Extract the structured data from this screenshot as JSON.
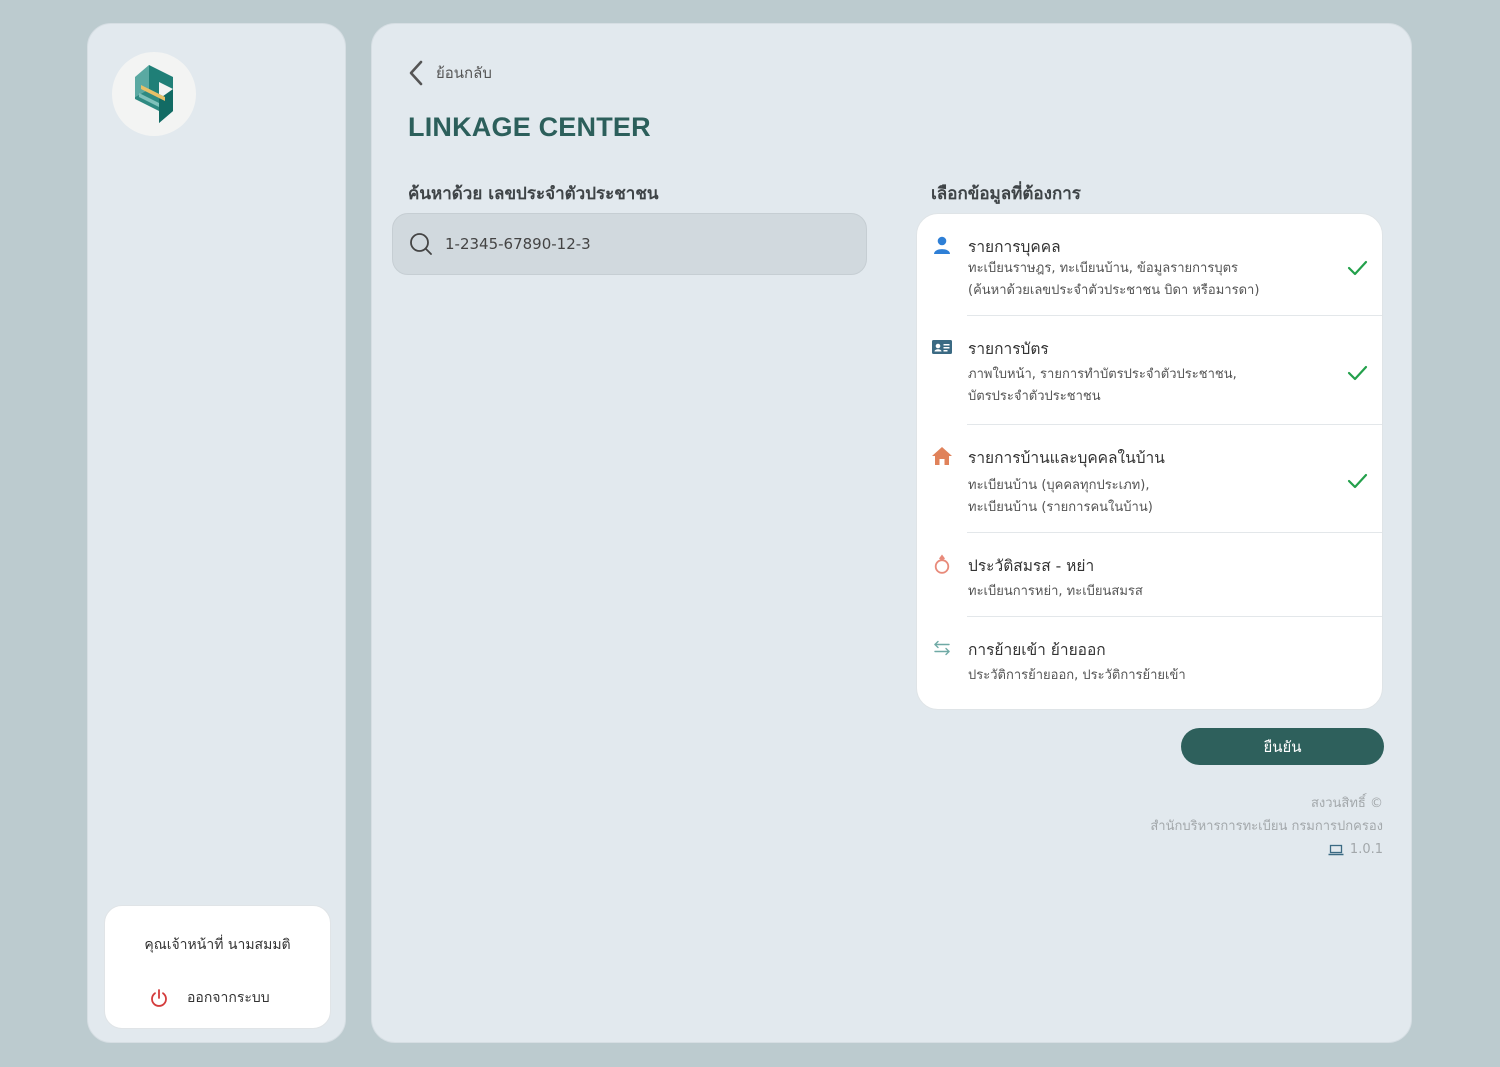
{
  "sidebar": {
    "user_name": "คุณเจ้าหน้าที่  นามสมมติ",
    "logout_label": "ออกจากระบบ"
  },
  "main": {
    "back_label": "ย้อนกลับ",
    "title": "LINKAGE CENTER",
    "search_label": "ค้นหาด้วย เลขประจำตัวประชาชน",
    "search_value": "1-2345-67890-12-3",
    "options_label": "เลือกข้อมูลที่ต้องการ",
    "options": [
      {
        "title": "รายการบุคคล",
        "desc_line1": "ทะเบียนราษฎร, ทะเบียนบ้าน, ข้อมูลรายการบุตร",
        "desc_line2": "(ค้นหาด้วยเลขประจำตัวประชาชน บิดา หรือมารดา)",
        "icon": "person-icon",
        "icon_color": "#2e7fd6",
        "selected": true
      },
      {
        "title": "รายการบัตร",
        "desc_line1": "ภาพใบหน้า, รายการทำบัตรประจำตัวประชาชน,",
        "desc_line2": "บัตรประจำตัวประชาชน",
        "icon": "id-card-icon",
        "icon_color": "#3b6a83",
        "selected": true
      },
      {
        "title": "รายการบ้านและบุคคลในบ้าน",
        "desc_line1": "ทะเบียนบ้าน (บุคคลทุกประเภท),",
        "desc_line2": "ทะเบียนบ้าน (รายการคนในบ้าน)",
        "icon": "house-icon",
        "icon_color": "#e0825a",
        "selected": true
      },
      {
        "title": "ประวัติสมรส - หย่า",
        "desc_line1": "ทะเบียนการหย่า, ทะเบียนสมรส",
        "icon": "ring-icon",
        "icon_color": "#e88a7a",
        "selected": false
      },
      {
        "title": "การย้ายเข้า ย้ายออก",
        "desc_line1": "ประวัติการย้ายออก, ประวัติการย้ายเข้า",
        "icon": "transfer-arrows-icon",
        "icon_color": "#6fa9a5",
        "selected": false
      }
    ],
    "confirm_label": "ยืนยัน",
    "footer": {
      "copyright": "สงวนสิทธิ์ ©",
      "org": "สำนักบริหารการทะเบียน กรมการปกครอง",
      "version": "1.0.1"
    }
  },
  "colors": {
    "accent": "#2e605c",
    "check": "#23a04b",
    "logout_icon": "#d43c3c"
  }
}
